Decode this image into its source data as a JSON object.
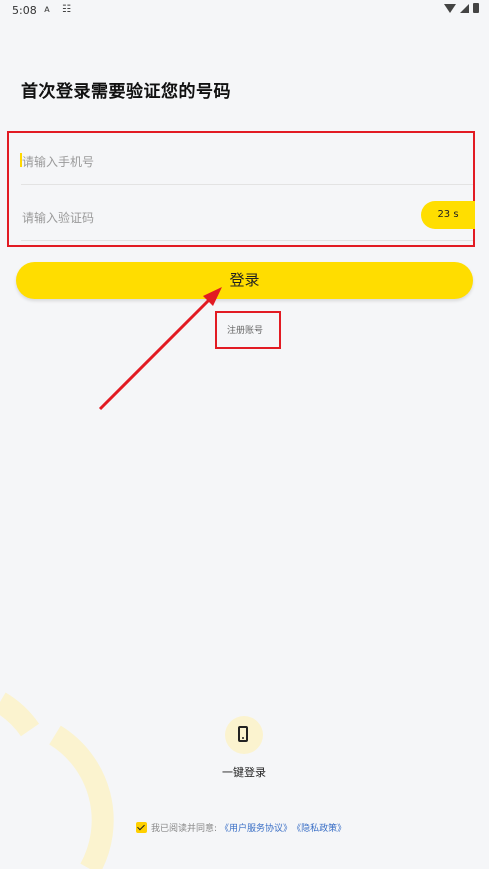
{
  "status_bar": {
    "time": "5:08",
    "icons": [
      "a-icon",
      "notification-icon",
      "wifi-icon",
      "cell-signal-icon",
      "battery-icon"
    ]
  },
  "page": {
    "title": "首次登录需要验证您的号码"
  },
  "form": {
    "phone_placeholder": "请输入手机号",
    "code_placeholder": "请输入验证码",
    "countdown": "23 s"
  },
  "actions": {
    "login_label": "登录",
    "register_label": "注册账号"
  },
  "quick_login": {
    "icon": "phone-icon",
    "label": "一键登录"
  },
  "agreement": {
    "checked": true,
    "prefix": "我已阅读并同意:",
    "user_agreement": "《用户服务协议》",
    "privacy_policy": "《隐私政策》"
  },
  "colors": {
    "accent": "#ffdd00",
    "highlight_box": "#e21b23",
    "link": "#3a6fc6",
    "background": "#f5f6f8"
  }
}
